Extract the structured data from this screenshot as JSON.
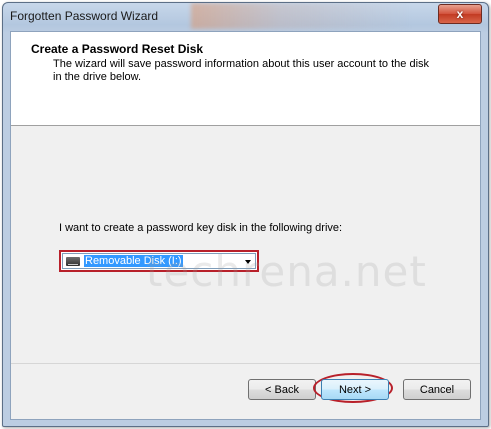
{
  "window": {
    "title": "Forgotten Password Wizard",
    "close_symbol": "x"
  },
  "header": {
    "title": "Create a Password Reset Disk",
    "description": "The wizard will save password information about this user account to the disk in the drive below."
  },
  "main": {
    "prompt": "I want to create a password key disk in the following drive:",
    "drive_select": {
      "selected_value": "Removable Disk (I:)",
      "icon": "removable-drive-icon"
    },
    "watermark": "techrena.net"
  },
  "buttons": {
    "back_label": "< Back",
    "next_label": "Next >",
    "cancel_label": "Cancel"
  },
  "colors": {
    "highlight": "#b8202a",
    "selection": "#3399ff"
  }
}
